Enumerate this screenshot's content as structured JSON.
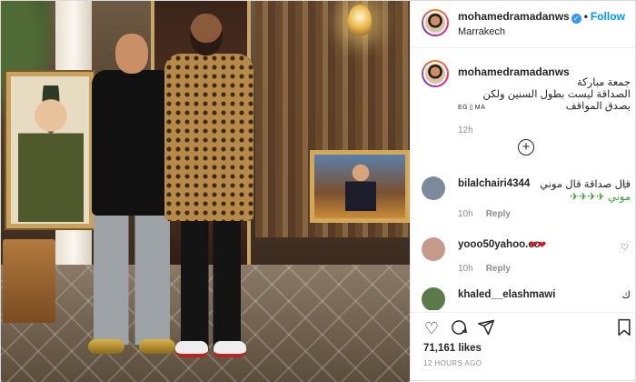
{
  "header": {
    "username": "mohamedramadanws",
    "follow_label": "Follow",
    "location": "Marrakech"
  },
  "caption": {
    "username": "mohamedramadanws",
    "text_line1": "جمعة مباركة",
    "text_line2": "الصداقة ليست بطول السنين ولكن",
    "text_line3": "بصدق المواقف",
    "flags": "EG ▯ MA",
    "time": "12h"
  },
  "comments": [
    {
      "username": "bilalchairi4344",
      "text": "قال صداقة قال موني",
      "text2": "موني ✈✈✈✈",
      "time": "10h",
      "reply_label": "Reply"
    },
    {
      "username": "yooo50yahoo.co",
      "text": "❤❤",
      "time": "10h",
      "reply_label": "Reply"
    },
    {
      "username": "khaled__elashmawi",
      "text": "ك",
      "time": "",
      "reply_label": ""
    }
  ],
  "actions": {
    "like_icon": "heart-outline-icon",
    "comment_icon": "comment-bubble-icon",
    "share_icon": "paper-plane-icon",
    "save_icon": "bookmark-icon"
  },
  "likes": "71,161 likes",
  "posted_ago": "12 HOURS AGO",
  "colors": {
    "follow": "#0095f6",
    "verified": "#3897f0",
    "meta": "#8e8e8e"
  }
}
